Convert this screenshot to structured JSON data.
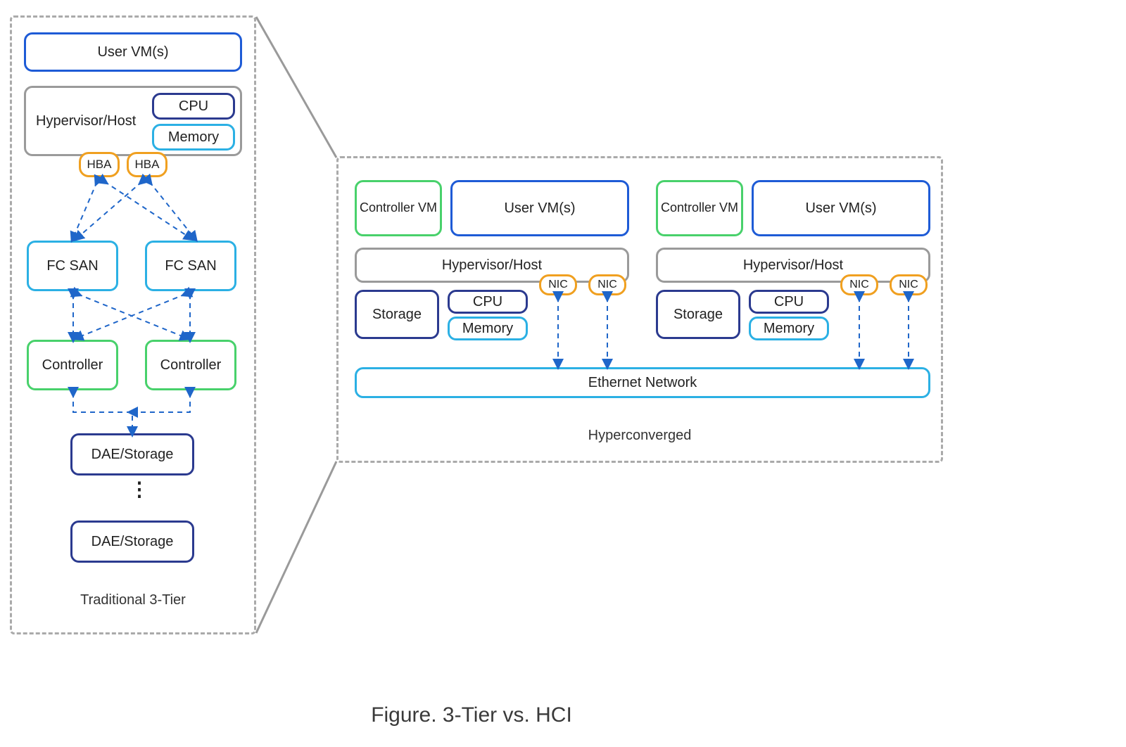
{
  "caption": "Figure. 3-Tier vs. HCI",
  "left": {
    "panel_label": "Traditional 3-Tier",
    "user_vm": "User VM(s)",
    "hypervisor": "Hypervisor/Host",
    "cpu": "CPU",
    "memory": "Memory",
    "hba1": "HBA",
    "hba2": "HBA",
    "fcsan1": "FC SAN",
    "fcsan2": "FC SAN",
    "ctrl1": "Controller",
    "ctrl2": "Controller",
    "dae1": "DAE/Storage",
    "dae2": "DAE/Storage",
    "ellipsis": "⋮"
  },
  "right": {
    "panel_label": "Hyperconverged",
    "ethernet": "Ethernet Network",
    "node1": {
      "cvm": "Controller VM",
      "user_vm": "User VM(s)",
      "hypervisor": "Hypervisor/Host",
      "storage": "Storage",
      "cpu": "CPU",
      "memory": "Memory",
      "nic1": "NIC",
      "nic2": "NIC"
    },
    "node2": {
      "cvm": "Controller VM",
      "user_vm": "User VM(s)",
      "hypervisor": "Hypervisor/Host",
      "storage": "Storage",
      "cpu": "CPU",
      "memory": "Memory",
      "nic1": "NIC",
      "nic2": "NIC"
    }
  },
  "colors": {
    "blue": "#1e5bd6",
    "darkblue": "#2b3a8f",
    "cyan": "#2bb0e4",
    "green": "#48d16b",
    "grey": "#9a9a9a",
    "orange": "#f0a020",
    "dash_grey": "#aaaaaa"
  }
}
